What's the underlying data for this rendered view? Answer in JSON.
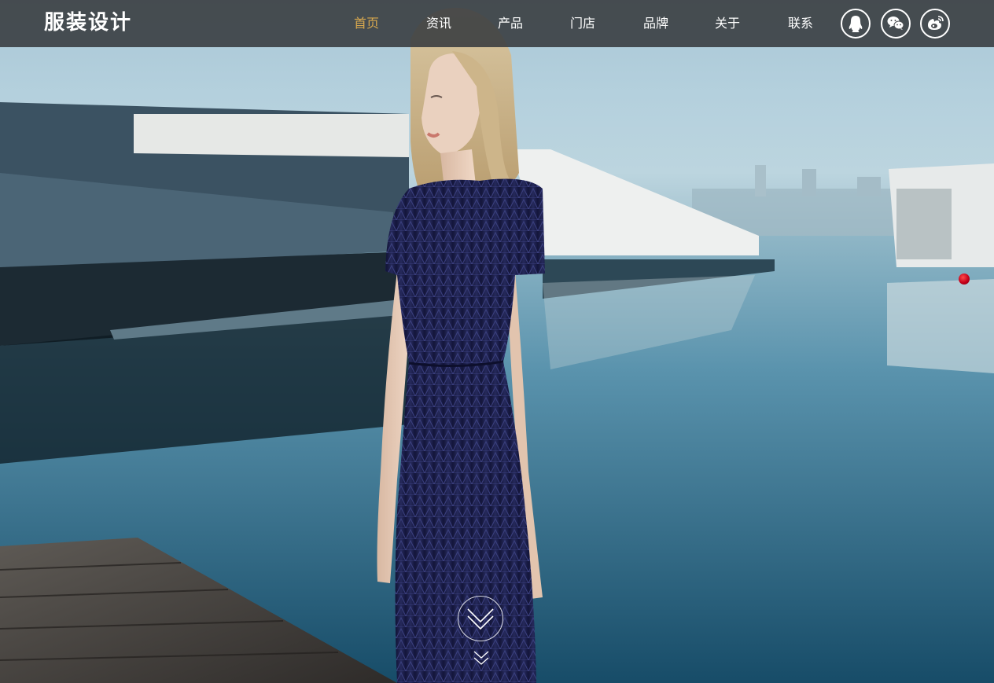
{
  "header": {
    "logo_text": "服装设计",
    "nav": [
      {
        "label": "首页",
        "active": true
      },
      {
        "label": "资讯",
        "active": false
      },
      {
        "label": "产品",
        "active": false
      },
      {
        "label": "门店",
        "active": false
      },
      {
        "label": "品牌",
        "active": false
      },
      {
        "label": "关于",
        "active": false
      },
      {
        "label": "联系",
        "active": false
      }
    ],
    "social_icons": [
      "qq-icon",
      "wechat-icon",
      "weibo-icon"
    ]
  },
  "hero": {
    "image": "model-in-navy-lace-dress-by-lake-photo"
  },
  "slider": {
    "active_dot_color": "#c4001a"
  },
  "scroll": {
    "icon": "chevron-double-down-icon"
  },
  "colors": {
    "navbar_bg": "#373a3e",
    "active_nav": "#d8a84e",
    "nav_text": "#ffffff"
  }
}
